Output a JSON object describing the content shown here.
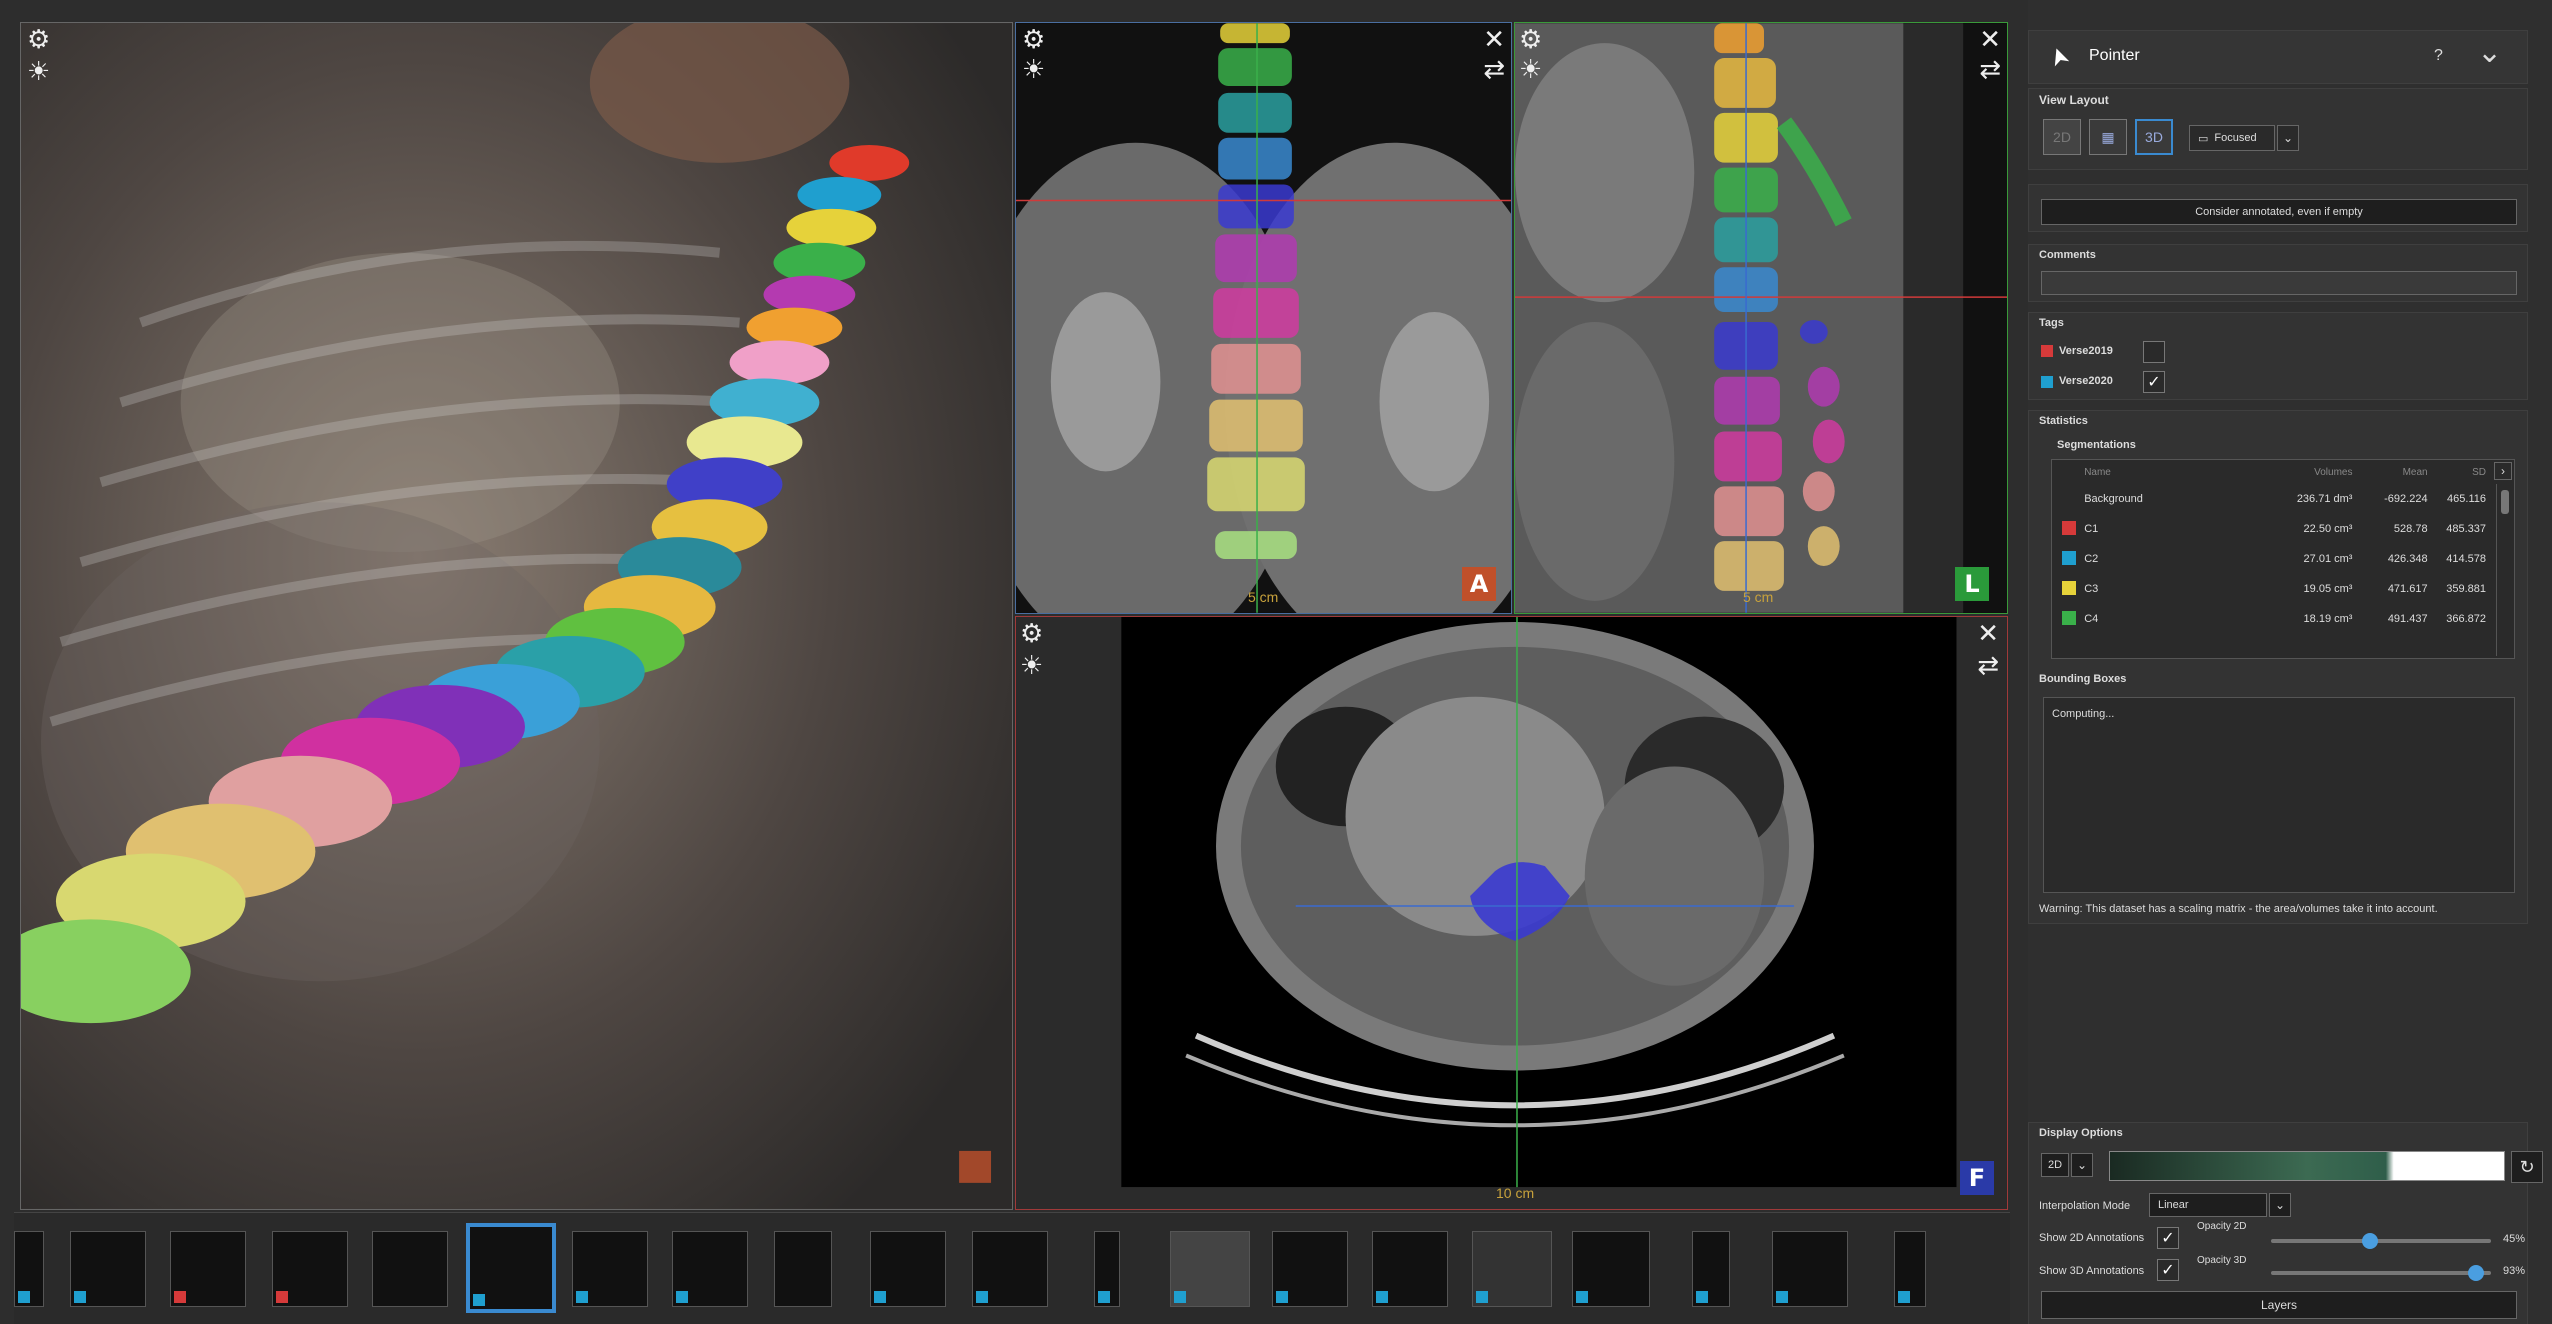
{
  "tool": {
    "name": "Pointer",
    "help": "?"
  },
  "view_layout": {
    "title": "View Layout",
    "btn_2d": "2D",
    "btn_3d": "3D",
    "mode": "Focused"
  },
  "annotated_button": "Consider annotated, even if empty",
  "comments": {
    "title": "Comments",
    "value": ""
  },
  "tags": {
    "title": "Tags",
    "items": [
      {
        "name": "Verse2019",
        "color": "#d63a3a",
        "checked": ""
      },
      {
        "name": "Verse2020",
        "color": "#1f9fcf",
        "checked": "✓"
      }
    ]
  },
  "statistics": {
    "title": "Statistics",
    "segmentations_title": "Segmentations",
    "columns": [
      "Name",
      "Volumes",
      "Mean",
      "SD"
    ],
    "rows": [
      {
        "name": "Background",
        "color": "",
        "volume": "236.71 dm³",
        "mean": "-692.224",
        "sd": "465.116"
      },
      {
        "name": "C1",
        "color": "#d63a3a",
        "volume": "22.50 cm³",
        "mean": "528.78",
        "sd": "485.337"
      },
      {
        "name": "C2",
        "color": "#1f9fcf",
        "volume": "27.01 cm³",
        "mean": "426.348",
        "sd": "414.578"
      },
      {
        "name": "C3",
        "color": "#e6d23a",
        "volume": "19.05 cm³",
        "mean": "471.617",
        "sd": "359.881"
      },
      {
        "name": "C4",
        "color": "#3ab04a",
        "volume": "18.19 cm³",
        "mean": "491.437",
        "sd": "366.872"
      }
    ]
  },
  "bounding_boxes": {
    "title": "Bounding Boxes",
    "status": "Computing..."
  },
  "warning": "Warning: This dataset has a scaling matrix - the area/volumes take it into account.",
  "display_options": {
    "title": "Display Options",
    "mode": "2D",
    "interpolation_label": "Interpolation Mode",
    "interpolation_value": "Linear",
    "show2d_label": "Show 2D Annotations",
    "show3d_label": "Show 3D Annotations",
    "opacity2d_label": "Opacity 2D",
    "opacity3d_label": "Opacity 3D",
    "opacity2d": "45%",
    "opacity3d": "93%",
    "opacity2d_value": 0.45,
    "opacity3d_value": 0.93,
    "layers_button": "Layers"
  },
  "viewports": {
    "coronal": {
      "scale": "5 cm",
      "orientation": "A",
      "color": "#c0502a"
    },
    "sagittal": {
      "scale": "5 cm",
      "orientation": "L",
      "color": "#2a9a3a"
    },
    "axial": {
      "scale": "10 cm",
      "orientation": "F",
      "color": "#2a3aa8"
    }
  },
  "icons": {
    "gear": "⚙",
    "brightness": "☀",
    "fullscreen": "✕",
    "swap": "⇄",
    "pointer": "➤",
    "collapse": "⌄",
    "reset": "↻",
    "check": "✓",
    "dropdown": "⌄"
  }
}
